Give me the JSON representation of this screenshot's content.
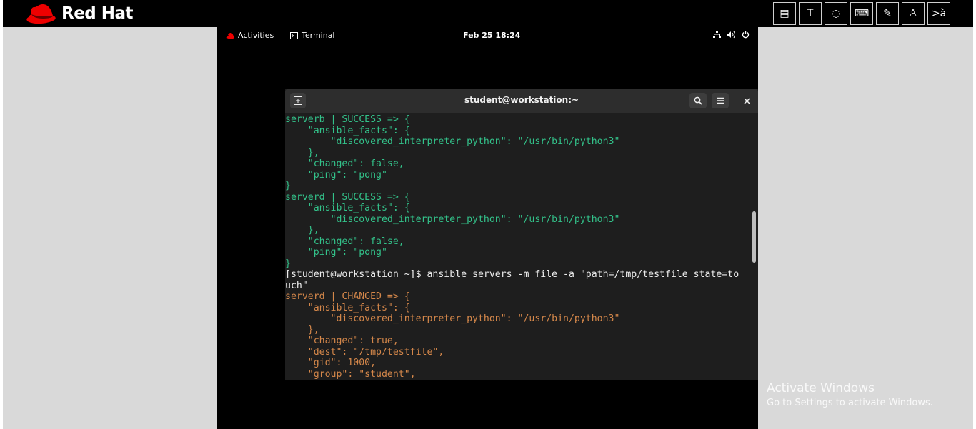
{
  "brand": {
    "name": "Red Hat"
  },
  "toolbar": {
    "tools": [
      {
        "name": "document-tool",
        "glyph": "▤"
      },
      {
        "name": "text-tool",
        "glyph": "T"
      },
      {
        "name": "circle-tool",
        "glyph": "◌"
      },
      {
        "name": "keyboard-tool",
        "glyph": "⌨"
      },
      {
        "name": "no-pen-tool",
        "glyph": "✎"
      },
      {
        "name": "user-tool",
        "glyph": "♙"
      },
      {
        "name": "translate-tool",
        "glyph": ">à"
      }
    ]
  },
  "gnome": {
    "activities": "Activities",
    "app": "Terminal",
    "clock": "Feb 25  18:24",
    "tray": [
      "network-icon",
      "volume-icon",
      "power-icon"
    ]
  },
  "terminal": {
    "title": "student@workstation:~",
    "lines": [
      {
        "text": "serverb | SUCCESS => {",
        "color": "green"
      },
      {
        "text": "    \"ansible_facts\": {",
        "color": "green"
      },
      {
        "text": "        \"discovered_interpreter_python\": \"/usr/bin/python3\"",
        "color": "green"
      },
      {
        "text": "    },",
        "color": "green"
      },
      {
        "text": "    \"changed\": false,",
        "color": "green"
      },
      {
        "text": "    \"ping\": \"pong\"",
        "color": "green"
      },
      {
        "text": "}",
        "color": "green"
      },
      {
        "text": "serverd | SUCCESS => {",
        "color": "green"
      },
      {
        "text": "    \"ansible_facts\": {",
        "color": "green"
      },
      {
        "text": "        \"discovered_interpreter_python\": \"/usr/bin/python3\"",
        "color": "green"
      },
      {
        "text": "    },",
        "color": "green"
      },
      {
        "text": "    \"changed\": false,",
        "color": "green"
      },
      {
        "text": "    \"ping\": \"pong\"",
        "color": "green"
      },
      {
        "text": "}",
        "color": "green"
      },
      {
        "text": "[student@workstation ~]$ ansible servers -m file -a \"path=/tmp/testfile state=to",
        "color": "white"
      },
      {
        "text": "uch\"",
        "color": "white"
      },
      {
        "text": "serverd | CHANGED => {",
        "color": "orange"
      },
      {
        "text": "    \"ansible_facts\": {",
        "color": "orange"
      },
      {
        "text": "        \"discovered_interpreter_python\": \"/usr/bin/python3\"",
        "color": "orange"
      },
      {
        "text": "    },",
        "color": "orange"
      },
      {
        "text": "    \"changed\": true,",
        "color": "orange"
      },
      {
        "text": "    \"dest\": \"/tmp/testfile\",",
        "color": "orange"
      },
      {
        "text": "    \"gid\": 1000,",
        "color": "orange"
      },
      {
        "text": "    \"group\": \"student\",",
        "color": "orange"
      }
    ]
  },
  "watermark": {
    "title": "Activate Windows",
    "subtitle": "Go to Settings to activate Windows."
  },
  "colors": {
    "green": "#33c28a",
    "white": "#ececec",
    "orange": "#d4874a"
  }
}
